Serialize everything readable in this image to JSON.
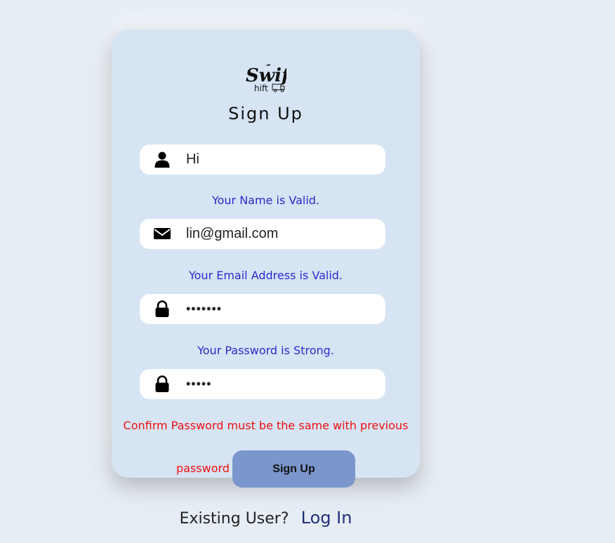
{
  "brand": {
    "logo_text_1": "Swift",
    "logo_text_2": "hift"
  },
  "form": {
    "title": "Sign Up",
    "name_field": {
      "icon": "user-icon",
      "value": "Hi",
      "valid_message": "Your Name is Valid."
    },
    "email_field": {
      "icon": "envelope-icon",
      "value": "lin@gmail.com",
      "valid_message": "Your Email Address is Valid."
    },
    "password_field": {
      "icon": "lock-icon",
      "value": "•••••••",
      "valid_message": "Your Password is Strong."
    },
    "confirm_field": {
      "icon": "lock-icon",
      "value": "•••••",
      "error_message_line1": "Confirm Password must be the same with previous",
      "error_message_line2": "password"
    },
    "submit_label": "Sign Up"
  },
  "footer": {
    "existing_text": "Existing User?",
    "login_link": "Log In"
  },
  "colors": {
    "background": "#e6edf5",
    "card": "#d6e4f3",
    "valid": "#2b2bcc",
    "error": "#ee1111",
    "button": "#7b96cc",
    "link": "#22307a"
  }
}
